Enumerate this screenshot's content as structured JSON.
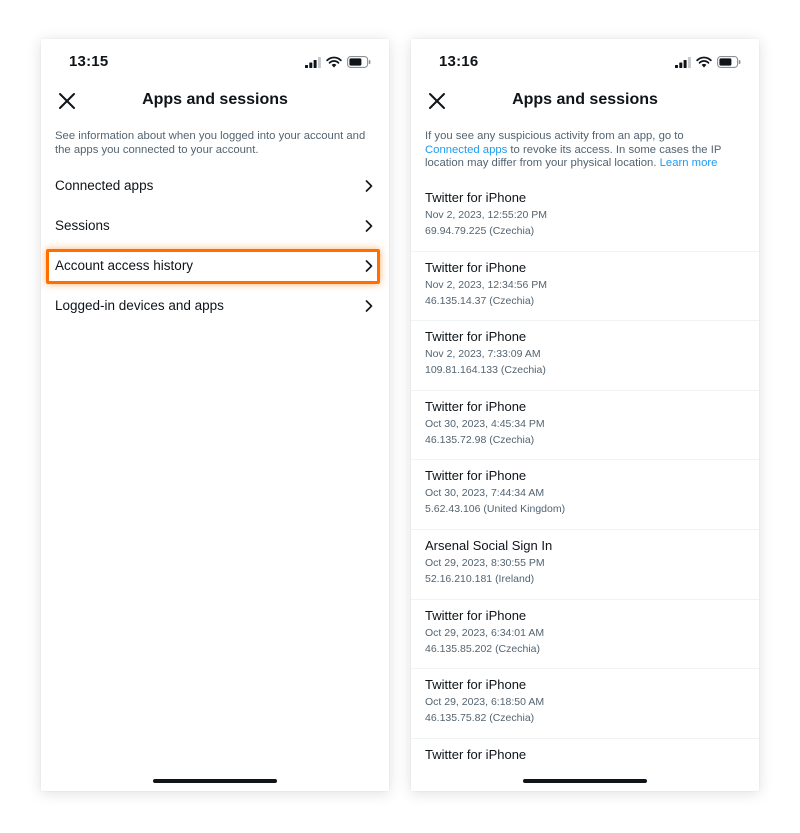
{
  "left": {
    "time": "13:15",
    "title": "Apps and sessions",
    "description": "See information about when you logged into your account and the apps you connected to your account.",
    "menu": [
      {
        "label": "Connected apps",
        "highlighted": false
      },
      {
        "label": "Sessions",
        "highlighted": false
      },
      {
        "label": "Account access history",
        "highlighted": true
      },
      {
        "label": "Logged-in devices and apps",
        "highlighted": false
      }
    ]
  },
  "right": {
    "time": "13:16",
    "title": "Apps and sessions",
    "notice": {
      "before": "If you see any suspicious activity from an app, go to ",
      "link1": "Connected apps",
      "middle": " to revoke its access. In some cases the IP location may differ from your physical location. ",
      "link2": "Learn more"
    },
    "history": [
      {
        "app": "Twitter for iPhone",
        "time": "Nov 2, 2023, 12:55:20 PM",
        "ip": "69.94.79.225 (Czechia)"
      },
      {
        "app": "Twitter for iPhone",
        "time": "Nov 2, 2023, 12:34:56 PM",
        "ip": "46.135.14.37 (Czechia)"
      },
      {
        "app": "Twitter for iPhone",
        "time": "Nov 2, 2023, 7:33:09 AM",
        "ip": "109.81.164.133 (Czechia)"
      },
      {
        "app": "Twitter for iPhone",
        "time": "Oct 30, 2023, 4:45:34 PM",
        "ip": "46.135.72.98 (Czechia)"
      },
      {
        "app": "Twitter for iPhone",
        "time": "Oct 30, 2023, 7:44:34 AM",
        "ip": "5.62.43.106 (United Kingdom)"
      },
      {
        "app": "Arsenal Social Sign In",
        "time": "Oct 29, 2023, 8:30:55 PM",
        "ip": "52.16.210.181 (Ireland)"
      },
      {
        "app": "Twitter for iPhone",
        "time": "Oct 29, 2023, 6:34:01 AM",
        "ip": "46.135.85.202 (Czechia)"
      },
      {
        "app": "Twitter for iPhone",
        "time": "Oct 29, 2023, 6:18:50 AM",
        "ip": "46.135.75.82 (Czechia)"
      },
      {
        "app": "Twitter for iPhone",
        "time": "",
        "ip": ""
      }
    ]
  },
  "colors": {
    "highlight": "#ff6f00",
    "link": "#1d9bf0",
    "secondary_text": "#536471"
  },
  "icons": [
    "signal-icon",
    "wifi-icon",
    "battery-icon",
    "close-icon",
    "chevron-right-icon"
  ]
}
